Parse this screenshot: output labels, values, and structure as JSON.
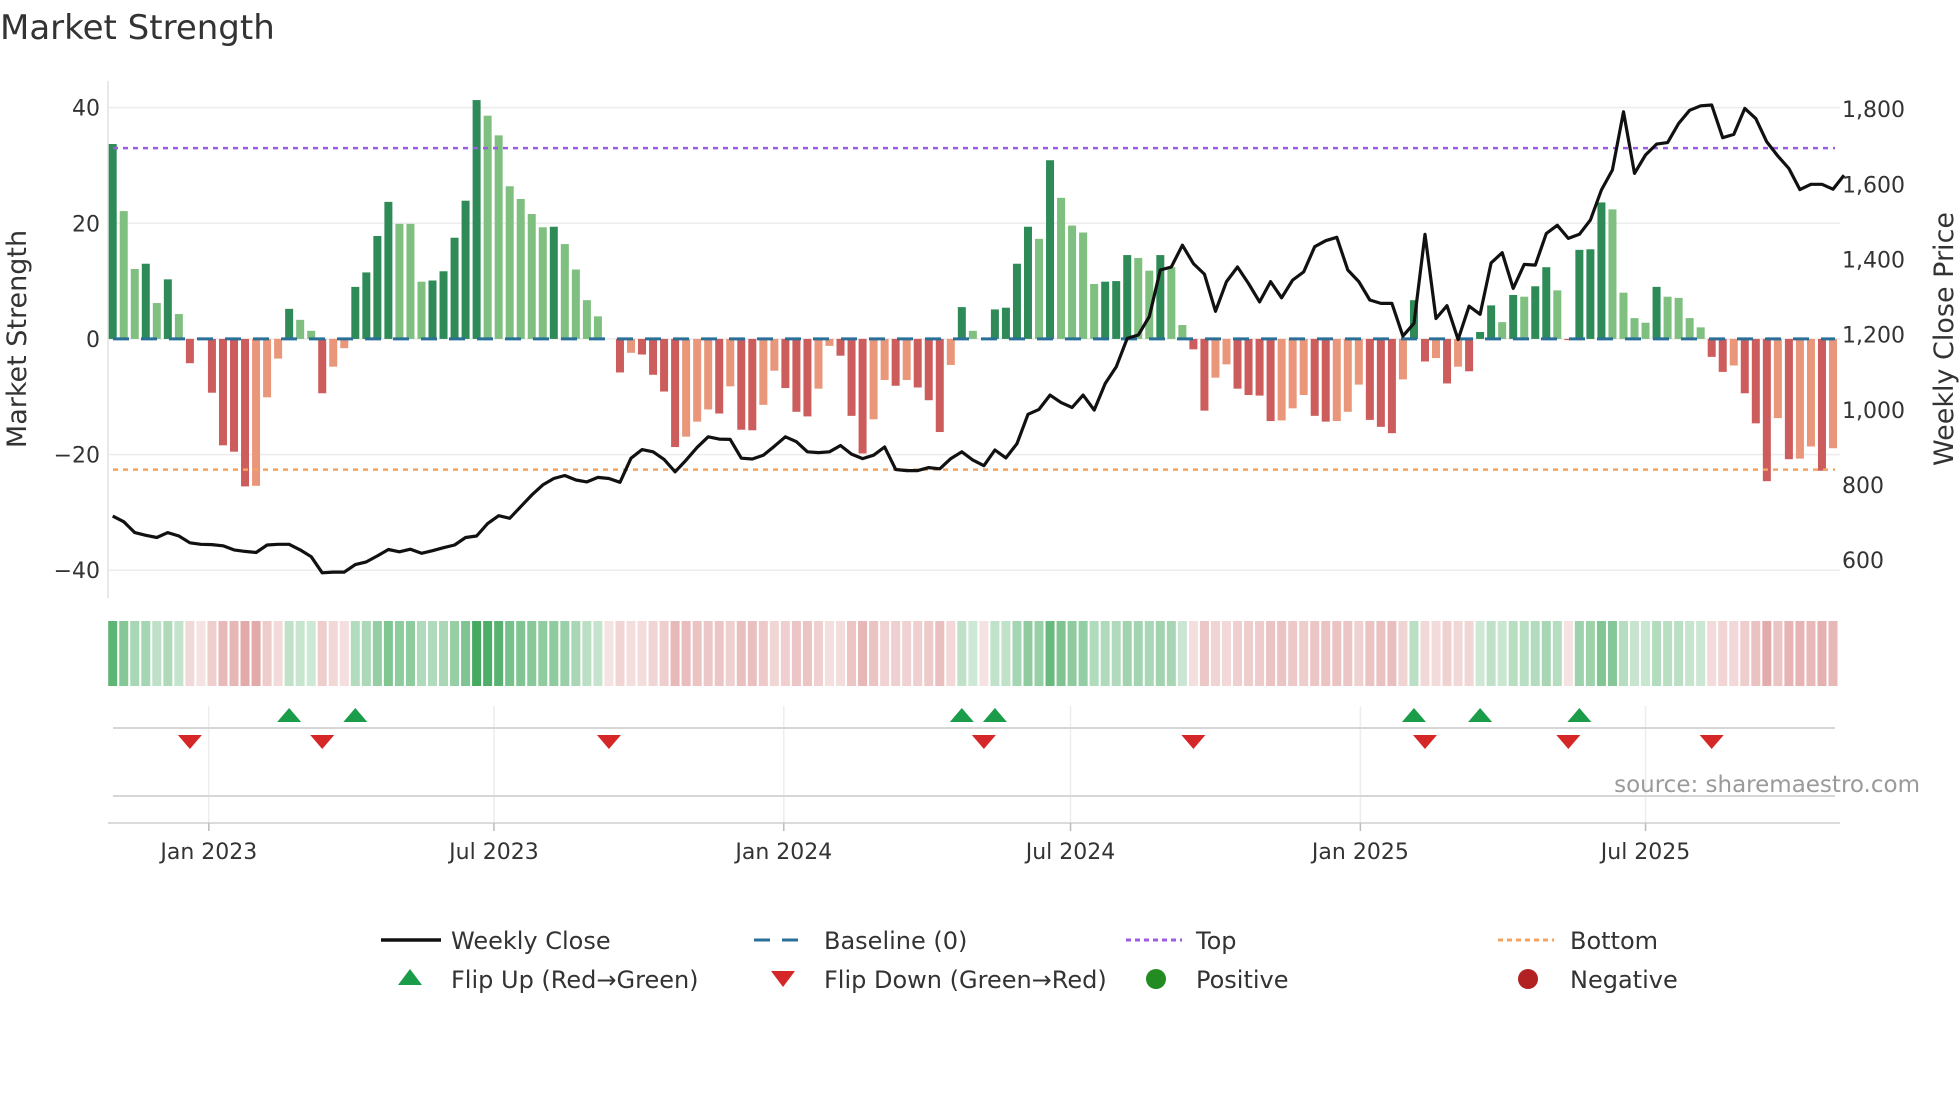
{
  "title": "Market Strength",
  "source_text": "source: sharemaestro.com",
  "chart_data": {
    "type": "bar",
    "title": "Market Strength",
    "frequency": "weekly",
    "start_date": "2022-11-01",
    "ylabel": "Market Strength",
    "y2label": "Weekly Close Price",
    "ylim": [
      -44.8,
      44.6
    ],
    "y2lim": [
      499,
      1875
    ],
    "yticks": [
      40,
      20,
      0,
      -20,
      -40
    ],
    "ytick_labels": [
      "40",
      "20",
      "0",
      "−20",
      "−40"
    ],
    "y2ticks": [
      600,
      800,
      1000,
      1200,
      1400,
      1600,
      1800
    ],
    "y2tick_labels": [
      "600",
      "800",
      "1,000",
      "1,200",
      "1,400",
      "1,600",
      "1,800"
    ],
    "xticks": [
      "2023-01-01",
      "2023-07-01",
      "2024-01-01",
      "2024-07-01",
      "2025-01-01",
      "2025-07-01"
    ],
    "xtick_labels": [
      "Jan 2023",
      "Jul 2023",
      "Jan 2024",
      "Jul 2024",
      "Jan 2025",
      "Jul 2025"
    ],
    "top_level": 33.0,
    "bottom_level": -22.6,
    "baseline": 0,
    "strength": [
      33.7,
      22.1,
      12.1,
      13.0,
      6.2,
      10.3,
      4.3,
      -4.2,
      0,
      -9.3,
      -18.4,
      -19.5,
      -25.5,
      -25.4,
      -10.1,
      -3.4,
      5.2,
      3.3,
      1.4,
      -9.4,
      -4.8,
      -1.6,
      9.0,
      11.5,
      17.8,
      23.7,
      19.9,
      19.9,
      9.9,
      10.1,
      11.7,
      17.5,
      23.9,
      41.3,
      38.6,
      35.2,
      26.4,
      24.2,
      21.6,
      19.3,
      19.4,
      16.4,
      12.0,
      6.7,
      3.9,
      0,
      -5.8,
      -2.4,
      -2.7,
      -6.2,
      -9.1,
      -18.7,
      -16.9,
      -14.3,
      -12.2,
      -12.9,
      -8.2,
      -15.7,
      -15.8,
      -11.4,
      -5.5,
      -8.5,
      -12.6,
      -13.4,
      -8.6,
      -1.2,
      -2.9,
      -13.3,
      -19.8,
      -13.9,
      -7.1,
      -8.1,
      -7.1,
      -8.4,
      -10.6,
      -16.1,
      -4.5,
      5.5,
      1.4,
      0,
      5.1,
      5.4,
      13.0,
      19.4,
      17.3,
      30.9,
      24.4,
      19.6,
      18.4,
      9.5,
      9.9,
      10.0,
      14.5,
      14.0,
      11.8,
      14.5,
      12.4,
      2.4,
      -1.8,
      -12.4,
      -6.7,
      -4.4,
      -8.6,
      -9.7,
      -9.8,
      -14.2,
      -14.1,
      -12.0,
      -9.7,
      -13.3,
      -14.3,
      -14.2,
      -12.6,
      -7.9,
      -14.0,
      -15.2,
      -16.3,
      -7.0,
      6.7,
      -3.9,
      -3.3,
      -7.7,
      -4.8,
      -5.6,
      1.2,
      5.8,
      2.9,
      7.6,
      7.3,
      9.1,
      12.4,
      8.4,
      -0.2,
      15.4,
      15.5,
      23.6,
      22.4,
      8.0,
      3.6,
      2.8,
      9.0,
      7.3,
      7.1,
      3.6,
      2.0,
      -3.1,
      -5.7,
      -4.6,
      -9.4,
      -14.6,
      -24.6,
      -13.7,
      -20.8,
      -20.7,
      -18.6,
      -22.8,
      -18.9
    ],
    "weekly_close": [
      717,
      702,
      673,
      666,
      660,
      673,
      664,
      646,
      642,
      641,
      638,
      627,
      623,
      620,
      640,
      642,
      642,
      627,
      609,
      566,
      568,
      568,
      588,
      595,
      611,
      628,
      622,
      629,
      618,
      625,
      633,
      640,
      660,
      664,
      697,
      718,
      711,
      742,
      773,
      800,
      817,
      825,
      813,
      808,
      820,
      817,
      807,
      871,
      894,
      888,
      868,
      835,
      866,
      900,
      928,
      922,
      921,
      871,
      869,
      879,
      903,
      928,
      915,
      888,
      886,
      888,
      905,
      882,
      870,
      879,
      901,
      841,
      838,
      838,
      846,
      843,
      870,
      888,
      866,
      851,
      893,
      872,
      910,
      988,
      1001,
      1039,
      1019,
      1006,
      1039,
      999,
      1070,
      1114,
      1190,
      1199,
      1248,
      1372,
      1380,
      1438,
      1389,
      1361,
      1262,
      1341,
      1380,
      1336,
      1287,
      1341,
      1298,
      1345,
      1367,
      1434,
      1450,
      1459,
      1372,
      1341,
      1292,
      1283,
      1283,
      1196,
      1230,
      1467,
      1243,
      1277,
      1187,
      1276,
      1254,
      1391,
      1418,
      1323,
      1387,
      1385,
      1469,
      1491,
      1456,
      1467,
      1505,
      1585,
      1638,
      1793,
      1629,
      1678,
      1707,
      1711,
      1762,
      1797,
      1809,
      1811,
      1724,
      1733,
      1802,
      1775,
      1713,
      1675,
      1642,
      1586,
      1600,
      1600,
      1587,
      1624
    ],
    "legend": [
      {
        "label": "Weekly Close",
        "symbol": "solid-line"
      },
      {
        "label": "Baseline (0)",
        "symbol": "dashed-line"
      },
      {
        "label": "Top",
        "symbol": "dotted-line"
      },
      {
        "label": "Bottom",
        "symbol": "dotted-line"
      },
      {
        "label": "Flip Up (Red→Green)",
        "symbol": "triangle-up"
      },
      {
        "label": "Flip Down (Green→Red)",
        "symbol": "triangle-down"
      },
      {
        "label": "Positive",
        "symbol": "circle"
      },
      {
        "label": "Negative",
        "symbol": "circle"
      }
    ],
    "legend_placement": "bottom-center",
    "colors": {
      "pos_strong": "#2e8b57",
      "pos_weak": "#7fbf7f",
      "neg_strong": "#cd5c5c",
      "neg_weak": "#e9967a",
      "line": "#111111",
      "baseline": "#2a6f97",
      "top": "#9b5de5",
      "bottom": "#f4a460",
      "flip_up": "#1a9c48",
      "flip_down": "#d62728",
      "positive": "#228b22",
      "negative": "#b22222"
    }
  }
}
